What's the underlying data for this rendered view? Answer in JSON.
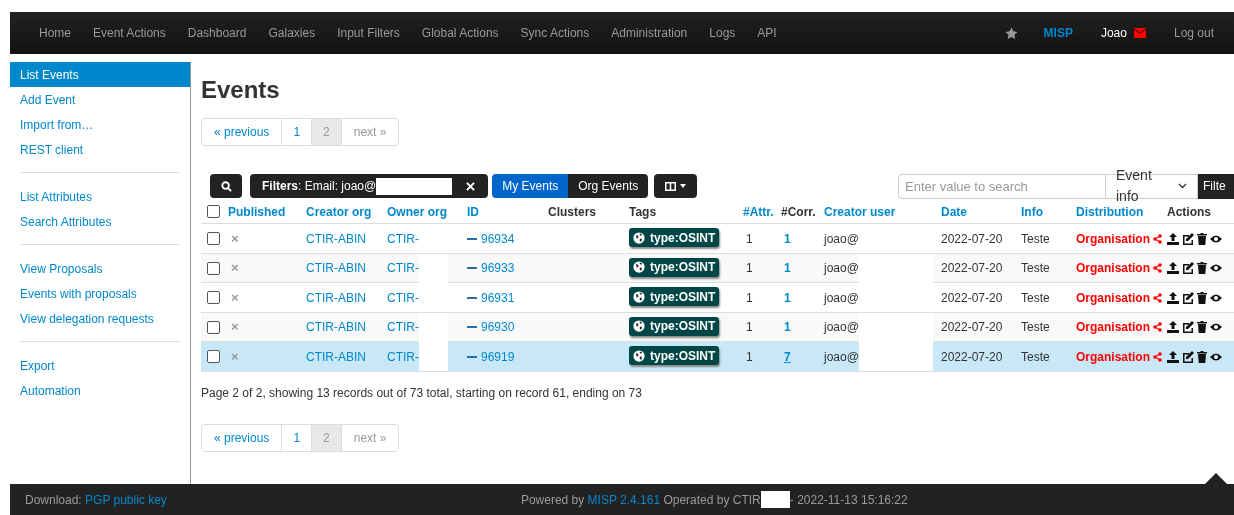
{
  "navbar": {
    "items": [
      "Home",
      "Event Actions",
      "Dashboard",
      "Galaxies",
      "Input Filters",
      "Global Actions",
      "Sync Actions",
      "Administration",
      "Logs",
      "API"
    ],
    "brand": "MISP",
    "user": "Joao",
    "logout": "Log out"
  },
  "sidebar": {
    "groups": [
      [
        {
          "label": "List Events",
          "selected": true
        },
        {
          "label": "Add Event",
          "selected": false
        },
        {
          "label": "Import from…",
          "selected": false
        },
        {
          "label": "REST client",
          "selected": false
        }
      ],
      [
        {
          "label": "List Attributes",
          "selected": false
        },
        {
          "label": "Search Attributes",
          "selected": false
        }
      ],
      [
        {
          "label": "View Proposals",
          "selected": false
        },
        {
          "label": "Events with proposals",
          "selected": false
        },
        {
          "label": "View delegation requests",
          "selected": false
        }
      ],
      [
        {
          "label": "Export",
          "selected": false
        },
        {
          "label": "Automation",
          "selected": false
        }
      ]
    ]
  },
  "title": "Events",
  "pagination_top": [
    {
      "label": "« previous",
      "selected": false
    },
    {
      "label": "1",
      "selected": false
    },
    {
      "label": "2",
      "selected": true
    },
    {
      "label": "next »",
      "selected": false,
      "disabled": true
    }
  ],
  "toolbar": {
    "filter_label": "Filters",
    "filter_text": ": Email: joao@",
    "view_tabs": [
      {
        "label": "My Events",
        "selected": true
      },
      {
        "label": "Org Events",
        "selected": false
      }
    ],
    "search": {
      "placeholder": "Enter value to search"
    },
    "search_field": "Event info",
    "filter_button": "Filte"
  },
  "table": {
    "all_checked": false,
    "columns": [
      {
        "label": "Published",
        "link": true
      },
      {
        "label": "Creator org",
        "link": true
      },
      {
        "label": "Owner org",
        "link": true
      },
      {
        "label": "ID",
        "link": true
      },
      {
        "label": "Clusters",
        "link": false
      },
      {
        "label": "Tags",
        "link": false
      },
      {
        "label": "#Attr.",
        "link": true
      },
      {
        "label": "#Corr.",
        "link": false
      },
      {
        "label": "Creator user",
        "link": true
      },
      {
        "label": "Date",
        "link": true
      },
      {
        "label": "Info",
        "link": true
      },
      {
        "label": "Distribution",
        "link": true
      },
      {
        "label": "Actions",
        "link": false
      }
    ],
    "rows": [
      {
        "checked": false,
        "selected": false,
        "published": "×",
        "creator_org": "CTIR-ABIN",
        "owner_org": "CTIR-",
        "id": "96934",
        "tag": "type:OSINT",
        "attr": "1",
        "corr": "1",
        "creator_user": "joao@",
        "date": "2022-07-20",
        "info": "Teste",
        "distribution": "Organisation"
      },
      {
        "checked": false,
        "selected": false,
        "published": "×",
        "creator_org": "CTIR-ABIN",
        "owner_org": "CTIR-",
        "id": "96933",
        "tag": "type:OSINT",
        "attr": "1",
        "corr": "1",
        "creator_user": "joao@",
        "date": "2022-07-20",
        "info": "Teste",
        "distribution": "Organisation"
      },
      {
        "checked": false,
        "selected": false,
        "published": "×",
        "creator_org": "CTIR-ABIN",
        "owner_org": "CTIR-",
        "id": "96931",
        "tag": "type:OSINT",
        "attr": "1",
        "corr": "1",
        "creator_user": "joao@",
        "date": "2022-07-20",
        "info": "Teste",
        "distribution": "Organisation"
      },
      {
        "checked": false,
        "selected": false,
        "published": "×",
        "creator_org": "CTIR-ABIN",
        "owner_org": "CTIR-",
        "id": "96930",
        "tag": "type:OSINT",
        "attr": "1",
        "corr": "1",
        "creator_user": "joao@",
        "date": "2022-07-20",
        "info": "Teste",
        "distribution": "Organisation"
      },
      {
        "checked": false,
        "selected": true,
        "published": "×",
        "creator_org": "CTIR-ABIN",
        "owner_org": "CTIR-",
        "id": "96919",
        "tag": "type:OSINT",
        "attr": "1",
        "corr": "7",
        "creator_user": "joao@",
        "date": "2022-07-20",
        "info": "Teste",
        "distribution": "Organisation"
      }
    ]
  },
  "summary": "Page 2 of 2, showing 13 records out of 73 total, starting on record 61, ending on 73",
  "pagination_bottom": [
    {
      "label": "« previous",
      "selected": false
    },
    {
      "label": "1",
      "selected": false
    },
    {
      "label": "2",
      "selected": true
    },
    {
      "label": "next »",
      "selected": false,
      "disabled": true
    }
  ],
  "footer": {
    "download_label": "Download: ",
    "download_link": "PGP public key",
    "powered_prefix": "Powered by ",
    "powered_link": "MISP 2.4.161",
    "operated": " Operated by CTIR",
    "timestamp": "- 2022-11-13 15:16:22"
  }
}
